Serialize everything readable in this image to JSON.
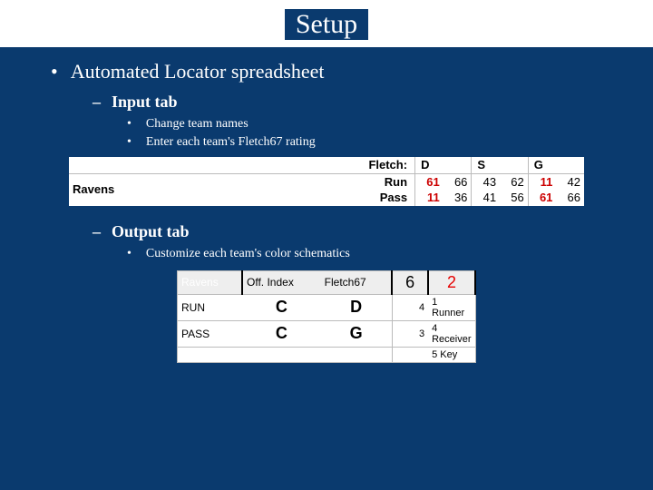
{
  "title": "Setup",
  "bullets": {
    "l1": "Automated Locator spreadsheet",
    "input": {
      "heading": "Input tab",
      "items": [
        "Change team names",
        "Enter each team's Fletch67 rating"
      ]
    },
    "output": {
      "heading": "Output tab",
      "items": [
        "Customize each team's color schematics"
      ]
    }
  },
  "input_table": {
    "fletch_label": "Fletch:",
    "groups": [
      "D",
      "S",
      "G"
    ],
    "team": "Ravens",
    "rows": [
      {
        "label": "Run",
        "values": [
          "61",
          "66",
          "43",
          "62",
          "11",
          "42"
        ]
      },
      {
        "label": "Pass",
        "values": [
          "11",
          "36",
          "41",
          "56",
          "61",
          "66"
        ]
      }
    ]
  },
  "output_table": {
    "team": "Ravens",
    "headers": [
      "Off. Index",
      "Fletch67"
    ],
    "top_right": [
      "6",
      "2"
    ],
    "rows": [
      {
        "label": "RUN",
        "off": "C",
        "fletch": "D",
        "right_small": "4",
        "right_text": "1 Runner"
      },
      {
        "label": "PASS",
        "off": "C",
        "fletch": "G",
        "right_small": "3",
        "right_text": "4 Receiver"
      }
    ],
    "footer": {
      "right_small": "",
      "right_text": "5 Key"
    }
  }
}
